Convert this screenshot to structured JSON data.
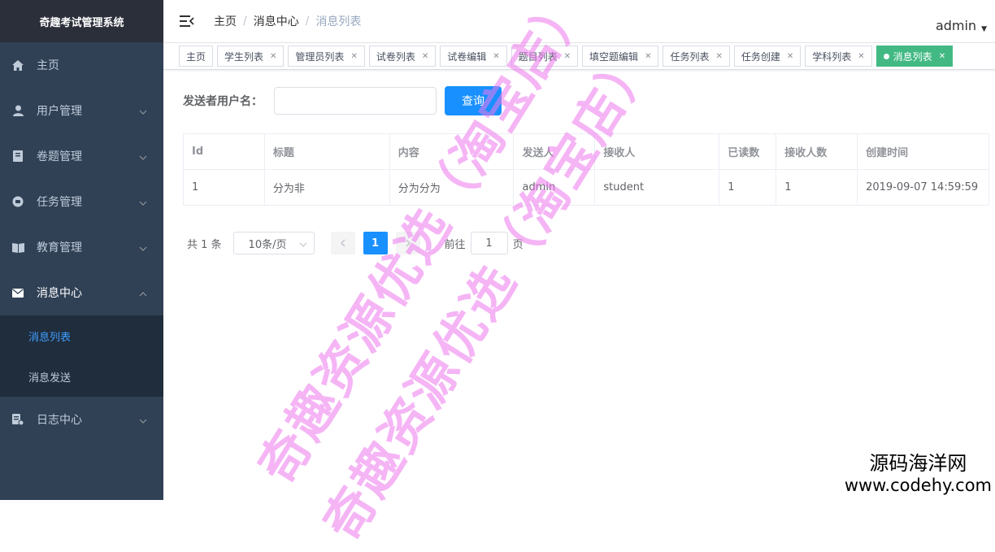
{
  "app": {
    "title": "奇趣考试管理系统"
  },
  "sidebar": {
    "items": [
      {
        "label": "主页",
        "icon": "home-icon"
      },
      {
        "label": "用户管理",
        "icon": "user-icon",
        "expandable": true
      },
      {
        "label": "卷题管理",
        "icon": "book-icon",
        "expandable": true
      },
      {
        "label": "任务管理",
        "icon": "task-icon",
        "expandable": true
      },
      {
        "label": "教育管理",
        "icon": "education-icon",
        "expandable": true
      },
      {
        "label": "消息中心",
        "icon": "mail-icon",
        "expandable": true,
        "open": true,
        "children": [
          {
            "label": "消息列表",
            "active": true
          },
          {
            "label": "消息发送"
          }
        ]
      },
      {
        "label": "日志中心",
        "icon": "log-icon",
        "expandable": true
      }
    ]
  },
  "header": {
    "breadcrumb": [
      "主页",
      "消息中心",
      "消息列表"
    ],
    "user": "admin"
  },
  "tags": [
    {
      "label": "主页",
      "closable": false
    },
    {
      "label": "学生列表",
      "closable": true
    },
    {
      "label": "管理员列表",
      "closable": true
    },
    {
      "label": "试卷列表",
      "closable": true
    },
    {
      "label": "试卷编辑",
      "closable": true
    },
    {
      "label": "题目列表",
      "closable": true
    },
    {
      "label": "填空题编辑",
      "closable": true
    },
    {
      "label": "任务列表",
      "closable": true
    },
    {
      "label": "任务创建",
      "closable": true
    },
    {
      "label": "学科列表",
      "closable": true
    },
    {
      "label": "消息列表",
      "closable": true,
      "active": true
    }
  ],
  "filter": {
    "label": "发送者用户名：",
    "input_value": "",
    "search_button": "查询"
  },
  "table": {
    "columns": [
      "Id",
      "标题",
      "内容",
      "发送人",
      "接收人",
      "已读数",
      "接收人数",
      "创建时间"
    ],
    "rows": [
      [
        "1",
        "分为非",
        "分为分为",
        "admin",
        "student",
        "1",
        "1",
        "2019-09-07 14:59:59"
      ]
    ]
  },
  "pagination": {
    "total": "共 1 条",
    "page_size": "10条/页",
    "current_page": "1",
    "goto_label": "前往",
    "goto_value": "1",
    "page_suffix": "页"
  },
  "watermarks": {
    "line1": "奇趣资源优选（淘宝店）",
    "line2": "奇趣资源优选（淘宝店）",
    "corner_line1": "源码海洋网",
    "corner_line2": "www.codehy.com"
  },
  "colors": {
    "sidebar_bg": "#304156",
    "sidebar_active": "#409eff",
    "primary": "#1890ff",
    "tag_active": "#42b983"
  }
}
